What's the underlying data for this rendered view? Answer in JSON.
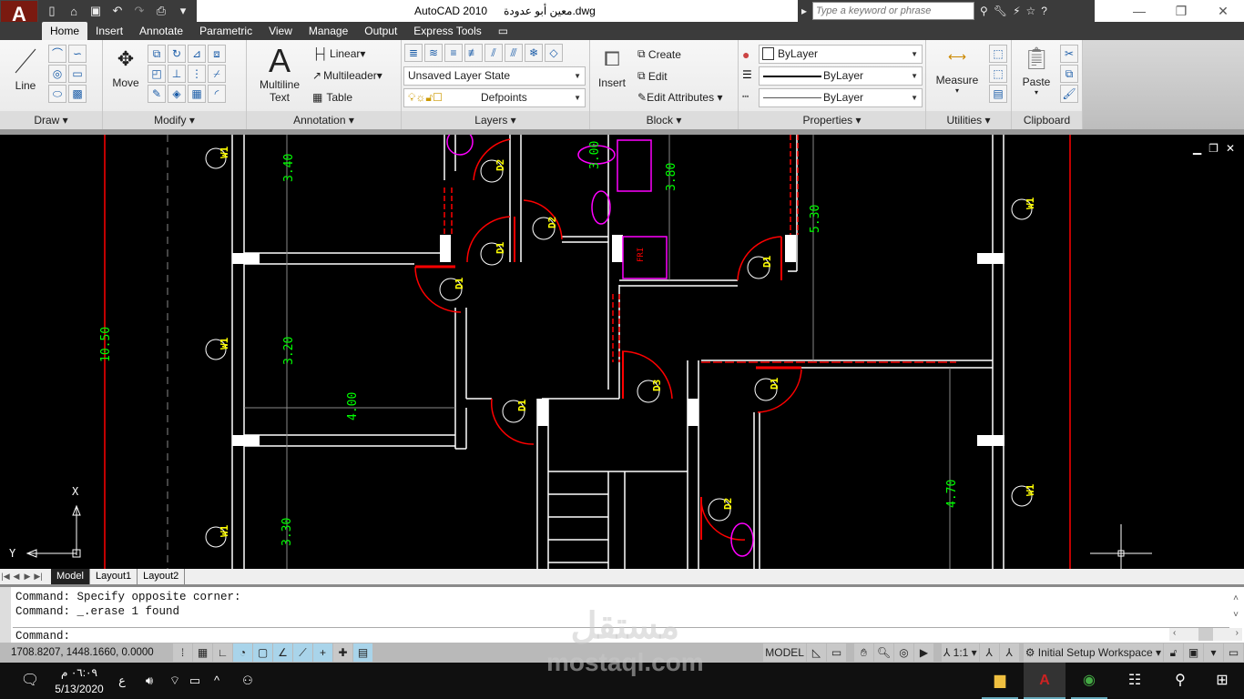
{
  "app": {
    "logo": "A",
    "title": "AutoCAD 2010",
    "file": "معين أبو عدودة.dwg"
  },
  "quick_access": [
    "new-icon",
    "open-icon",
    "save-icon",
    "undo-icon",
    "redo-icon",
    "plot-icon"
  ],
  "search": {
    "placeholder": "Type a keyword or phrase"
  },
  "ribbon_tabs": [
    {
      "label": "Home",
      "active": true
    },
    {
      "label": "Insert"
    },
    {
      "label": "Annotate"
    },
    {
      "label": "Parametric"
    },
    {
      "label": "View"
    },
    {
      "label": "Manage"
    },
    {
      "label": "Output"
    },
    {
      "label": "Express Tools"
    }
  ],
  "panels": {
    "draw": {
      "title": "Draw",
      "line": "Line"
    },
    "modify": {
      "title": "Modify",
      "move": "Move"
    },
    "annotation": {
      "title": "Annotation",
      "mtext1": "Multiline",
      "mtext2": "Text",
      "linear": "Linear",
      "multileader": "Multileader",
      "table": "Table"
    },
    "layers": {
      "title": "Layers",
      "layer_state": "Unsaved Layer State",
      "current_layer": "Defpoints"
    },
    "block": {
      "title": "Block",
      "insert": "Insert",
      "create": "Create",
      "edit": "Edit",
      "edit_attributes": "Edit Attributes"
    },
    "properties": {
      "title": "Properties",
      "color": "ByLayer",
      "lineweight": "ByLayer",
      "linetype": "ByLayer"
    },
    "utilities": {
      "title": "Utilities",
      "measure": "Measure"
    },
    "clipboard": {
      "title": "Clipboard",
      "paste": "Paste"
    }
  },
  "drawing": {
    "dimensions": {
      "d1050": "10.50",
      "d340": "3.40",
      "d320": "3.20",
      "d400": "4.00",
      "d330": "3.30",
      "d380": "3.80",
      "d530": "5.30",
      "d470": "4.70",
      "d300": "3.00"
    },
    "tags": {
      "w1": "W1",
      "d1": "D1",
      "d2": "D2",
      "d3": "D3",
      "fr": "FRI"
    },
    "ucs": {
      "x": "X",
      "y": "Y"
    },
    "colors": {
      "wall": "#ffffff",
      "door": "#ff0000",
      "dim": "#00ff00",
      "tag": "#ffff00",
      "fixture": "#ff00ff"
    }
  },
  "layout_tabs": [
    {
      "label": "Model",
      "active": true
    },
    {
      "label": "Layout1"
    },
    {
      "label": "Layout2"
    }
  ],
  "command": {
    "lines": [
      "Command: Specify opposite corner:",
      "Command: _.erase 1 found"
    ],
    "prompt": "Command:"
  },
  "status": {
    "coords": "1708.8207, 1448.1660, 0.0000",
    "model": "MODEL",
    "scale": "1:1",
    "workspace": "Initial Setup Workspace"
  },
  "taskbar": {
    "time": "٠٦:٠٩ م",
    "date": "5/13/2020",
    "lang": "ع"
  },
  "watermark": {
    "ar": "مستقل",
    "en": "mostaql.com"
  }
}
